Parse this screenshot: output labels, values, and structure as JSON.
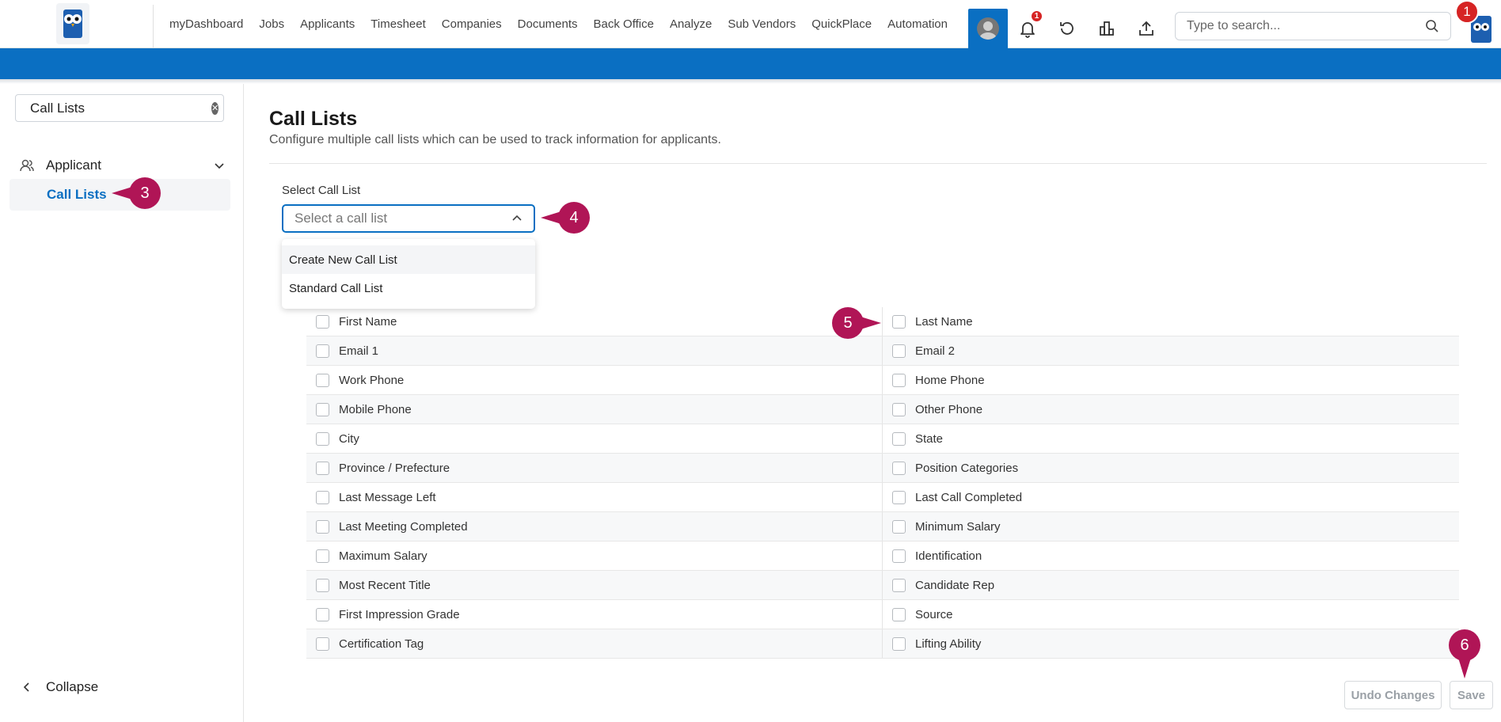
{
  "nav": {
    "items": [
      "myDashboard",
      "Jobs",
      "Applicants",
      "Timesheet",
      "Companies",
      "Documents",
      "Back Office",
      "Analyze",
      "Sub Vendors",
      "QuickPlace",
      "Automation"
    ],
    "notification_count": "1",
    "search_placeholder": "Type to search...",
    "accent_color": "#0a6fc2"
  },
  "markers": {
    "m1": "1",
    "m3": "3",
    "m4": "4",
    "m5": "5",
    "m6": "6",
    "marker_color": "#b01556"
  },
  "sidebar": {
    "search_value": "Call Lists",
    "group_label": "Applicant",
    "item_label": "Call Lists",
    "collapse_label": "Collapse"
  },
  "main": {
    "title": "Call Lists",
    "description": "Configure multiple call lists which can be used to track information for applicants.",
    "select_label": "Select Call List",
    "select_placeholder": "Select a call list",
    "dropdown_options": [
      "Create New Call List",
      "Standard Call List"
    ],
    "fields": [
      [
        "First Name",
        "Last Name"
      ],
      [
        "Email 1",
        "Email 2"
      ],
      [
        "Work Phone",
        "Home Phone"
      ],
      [
        "Mobile Phone",
        "Other Phone"
      ],
      [
        "City",
        "State"
      ],
      [
        "Province / Prefecture",
        "Position Categories"
      ],
      [
        "Last Message Left",
        "Last Call Completed"
      ],
      [
        "Last Meeting Completed",
        "Minimum Salary"
      ],
      [
        "Maximum Salary",
        "Identification"
      ],
      [
        "Most Recent Title",
        "Candidate Rep"
      ],
      [
        "First Impression Grade",
        "Source"
      ],
      [
        "Certification Tag",
        "Lifting Ability"
      ]
    ],
    "undo_label": "Undo Changes",
    "save_label": "Save"
  }
}
